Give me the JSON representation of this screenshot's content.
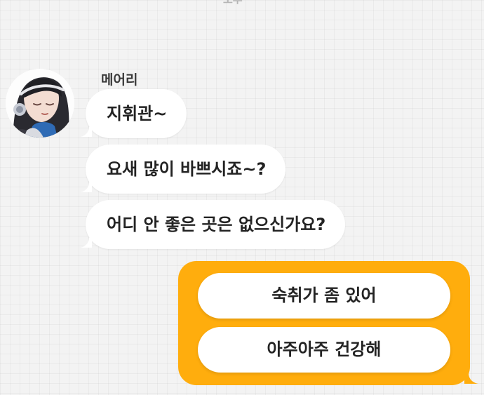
{
  "header": {
    "cut_off_text": "오후"
  },
  "conversation": {
    "sender_name": "메어리",
    "avatar_icon": "character-portrait",
    "messages": [
      {
        "text": "지휘관~"
      },
      {
        "text": "요새 많이 바쁘시죠~?"
      },
      {
        "text": "어디 안 좋은 곳은 없으신가요?"
      }
    ]
  },
  "reply_choices": {
    "panel_color": "#ffad0d",
    "options": [
      {
        "label": "숙취가 좀 있어"
      },
      {
        "label": "아주아주 건강해"
      }
    ]
  }
}
